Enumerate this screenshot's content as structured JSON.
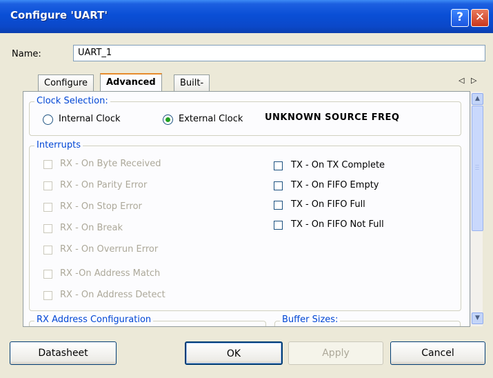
{
  "window": {
    "title": "Configure 'UART'",
    "help_glyph": "?",
    "close_glyph": "✕"
  },
  "name_field": {
    "label": "Name:",
    "value": "UART_1"
  },
  "tabs": [
    {
      "label": "Configure"
    },
    {
      "label": "Advanced"
    },
    {
      "label": "Built-in"
    }
  ],
  "tab_scroll": {
    "left": "◁",
    "right": "▷"
  },
  "clock": {
    "title": "Clock Selection:",
    "internal_label": "Internal Clock",
    "external_label": "External Clock",
    "selected": "external",
    "status": "UNKNOWN SOURCE FREQ"
  },
  "interrupts": {
    "title": "Interrupts",
    "rx": [
      {
        "label": "RX - On Byte Received"
      },
      {
        "label": "RX - On Parity Error"
      },
      {
        "label": "RX - On Stop Error"
      },
      {
        "label": "RX - On Break"
      },
      {
        "label": "RX - On Overrun Error"
      },
      {
        "label": "RX -On Address Match"
      },
      {
        "label": "RX - On Address Detect"
      }
    ],
    "tx": [
      {
        "label": "TX - On TX Complete"
      },
      {
        "label": "TX - On FIFO Empty"
      },
      {
        "label": "TX - On FIFO Full"
      },
      {
        "label": "TX - On FIFO Not Full"
      }
    ]
  },
  "rx_address": {
    "title": "RX Address Configuration"
  },
  "buffer_sizes": {
    "title": "Buffer Sizes:"
  },
  "buttons": {
    "datasheet": "Datasheet",
    "ok": "OK",
    "apply": "Apply",
    "cancel": "Cancel"
  },
  "colors": {
    "title_bar": "#0a4fd6",
    "group_title": "#0046d5",
    "disabled_text": "#aca899",
    "radio_dot": "#21a121"
  }
}
